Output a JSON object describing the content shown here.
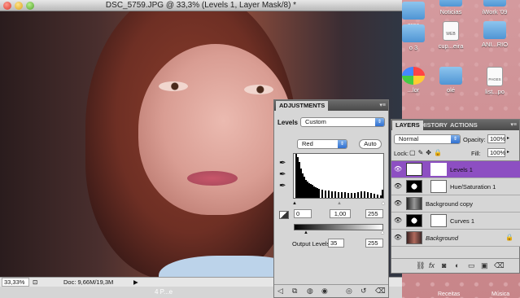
{
  "document": {
    "title": "DSC_5759.JPG @ 33,3% (Levels 1, Layer Mask/8) *",
    "zoom": "33,33%",
    "doc_info": "Doc: 9,66M/19,3M"
  },
  "desktop": {
    "icons": [
      {
        "label": "eras",
        "kind": "folder"
      },
      {
        "label": "Noticias",
        "kind": "folder"
      },
      {
        "label": "iWork '09",
        "kind": "folder"
      },
      {
        "label": "o 3",
        "kind": "folder"
      },
      {
        "label": "cup...eira",
        "kind": "doc"
      },
      {
        "label": "ANI...RIO",
        "kind": "folder"
      },
      {
        "label": "...lor",
        "kind": "app"
      },
      {
        "label": "olé",
        "kind": "folder"
      },
      {
        "label": "list...po",
        "kind": "doc"
      }
    ],
    "doc_badge": "WEB",
    "doc_badge2": "PAGES"
  },
  "adjustments": {
    "tab": "ADJUSTMENTS",
    "heading": "Levels",
    "preset": "Custom",
    "channel": "Red",
    "auto_label": "Auto",
    "input_black": "0",
    "input_gamma": "1,00",
    "input_white": "255",
    "output_label": "Output Levels:",
    "output_black": "35",
    "output_white": "255"
  },
  "layers": {
    "tabs": [
      "LAYERS",
      "HISTORY",
      "ACTIONS"
    ],
    "blend_mode": "Normal",
    "opacity_label": "Opacity:",
    "opacity": "100%",
    "lock_label": "Lock:",
    "fill_label": "Fill:",
    "fill": "100%",
    "rows": [
      {
        "name": "Levels 1",
        "selected": true
      },
      {
        "name": "Hue/Saturation 1",
        "selected": false
      },
      {
        "name": "Background copy",
        "selected": false
      },
      {
        "name": "Curves 1",
        "selected": false
      },
      {
        "name": "Background",
        "selected": false
      }
    ]
  },
  "taskbar": {
    "label1": "4 P...e",
    "label2": "Receitas",
    "label3": "Música"
  },
  "colors": {
    "selection": "#8d4fc2",
    "accent_blue": "#2f6fd0"
  }
}
